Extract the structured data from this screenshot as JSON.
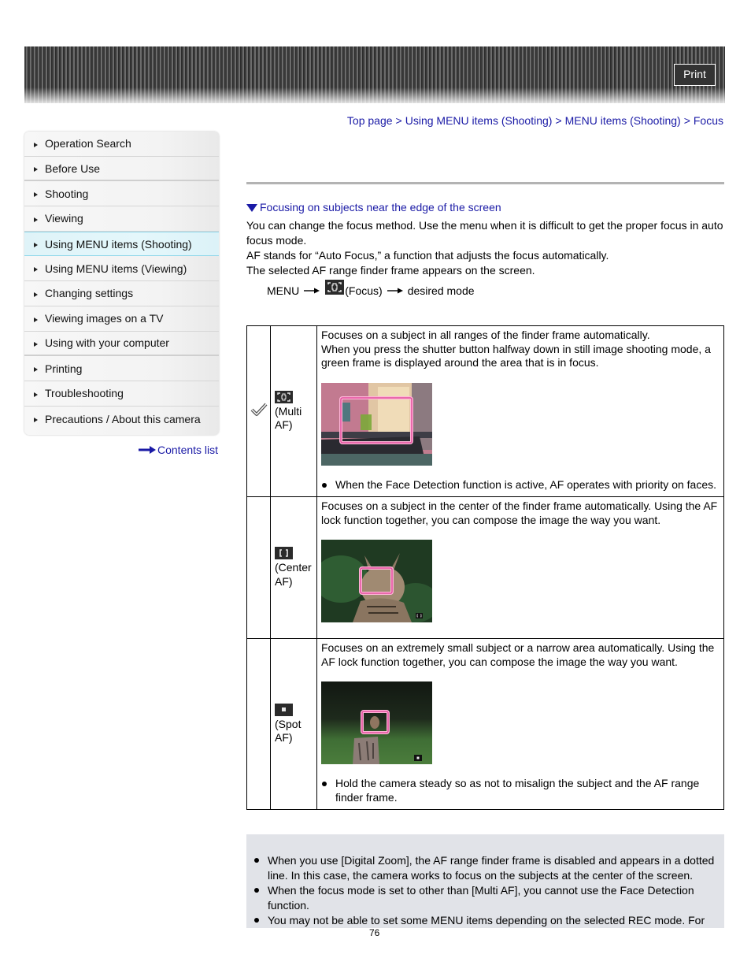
{
  "header": {
    "print_label": "Print"
  },
  "breadcrumb": [
    {
      "label": "Top page"
    },
    {
      "label": "Using MENU items (Shooting)"
    },
    {
      "label": "MENU items (Shooting)"
    },
    {
      "label": "Focus"
    }
  ],
  "breadcrumb_separator": ">",
  "sidebar": {
    "items": [
      {
        "label": "Operation Search"
      },
      {
        "label": "Before Use"
      },
      {
        "label": "Shooting"
      },
      {
        "label": "Viewing"
      },
      {
        "label": "Using MENU items (Shooting)",
        "active": true
      },
      {
        "label": "Using MENU items (Viewing)"
      },
      {
        "label": "Changing settings"
      },
      {
        "label": "Viewing images on a TV"
      },
      {
        "label": "Using with your computer"
      },
      {
        "label": "Printing"
      },
      {
        "label": "Troubleshooting"
      },
      {
        "label": "Precautions / About this camera"
      }
    ],
    "contents_link": "Contents list"
  },
  "main": {
    "section_link": "Focusing on subjects near the edge of the screen",
    "intro": [
      "You can change the focus method. Use the menu when it is difficult to get the proper focus in auto focus mode.",
      "AF stands for “Auto Focus,” a function that adjusts the focus automatically.",
      "The selected AF range finder frame appears on the screen."
    ],
    "menu_path": {
      "start": "MENU",
      "icon": "multi-af-focus-icon",
      "middle": "(Focus)",
      "end": "desired mode"
    },
    "modes": [
      {
        "default": true,
        "icon": "multi-af-icon",
        "label": "(Multi AF)",
        "description": [
          "Focuses on a subject in all ranges of the finder frame automatically.",
          "When you press the shutter button halfway down in still image shooting mode, a green frame is displayed around the area that is in focus."
        ],
        "image": "gondola-canal-photo",
        "note": "When the Face Detection function is active, AF operates with priority on faces."
      },
      {
        "default": false,
        "icon": "center-af-icon",
        "label": "(Center AF)",
        "description": [
          "Focuses on a subject in the center of the finder frame automatically. Using the AF lock function together, you can compose the image the way you want."
        ],
        "image": "cat-photo",
        "note": ""
      },
      {
        "default": false,
        "icon": "spot-af-icon",
        "label": "(Spot AF)",
        "description": [
          "Focuses on an extremely small subject or a narrow area automatically. Using the AF lock function together, you can compose the image the way you want."
        ],
        "image": "bird-on-post-photo",
        "note": "Hold the camera steady so as not to misalign the subject and the AF range finder frame."
      }
    ],
    "notes": [
      "When you use [Digital Zoom], the AF range finder frame is disabled and appears in a dotted line. In this case, the camera works to focus on the subjects at the center of the screen.",
      "When the focus mode is set to other than [Multi AF], you cannot use the Face Detection function.",
      "You may not be able to set some MENU items depending on the selected REC mode. For"
    ]
  },
  "page_number": "76",
  "colors": {
    "link": "#1a1aa6",
    "active_item_bg": "#dff3f8",
    "active_item_border": "#8fd7ea",
    "notes_bg": "#e1e3e8",
    "af_frame": "#e85aa8"
  }
}
